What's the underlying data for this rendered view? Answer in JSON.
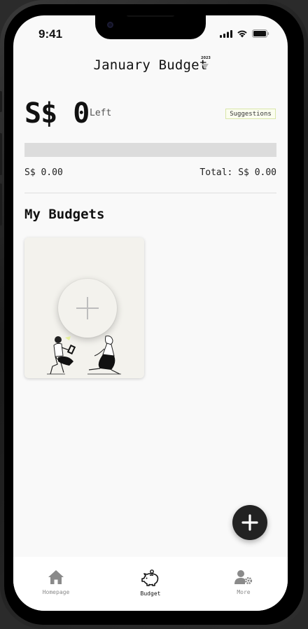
{
  "status_bar": {
    "time": "9:41"
  },
  "header": {
    "title": "January Budget",
    "year": "2023"
  },
  "summary": {
    "amount_left": "S$ 0",
    "left_label": "Left",
    "suggestions_label": "Suggestions",
    "spent": "S$ 0.00",
    "total": "Total: S$ 0.00",
    "progress_fraction": 0
  },
  "budgets": {
    "section_title": "My Budgets",
    "add_card_icon": "plus-icon"
  },
  "fab": {
    "icon": "plus-icon"
  },
  "tab_bar": {
    "items": [
      {
        "label": "Homepage",
        "icon": "home-icon",
        "active": false
      },
      {
        "label": "Budget",
        "icon": "piggy-bank-icon",
        "active": true
      },
      {
        "label": "More",
        "icon": "user-settings-icon",
        "active": false
      }
    ]
  },
  "colors": {
    "inactive_tab": "#8a8a8a",
    "active_tab": "#111111",
    "fab": "#222222"
  }
}
